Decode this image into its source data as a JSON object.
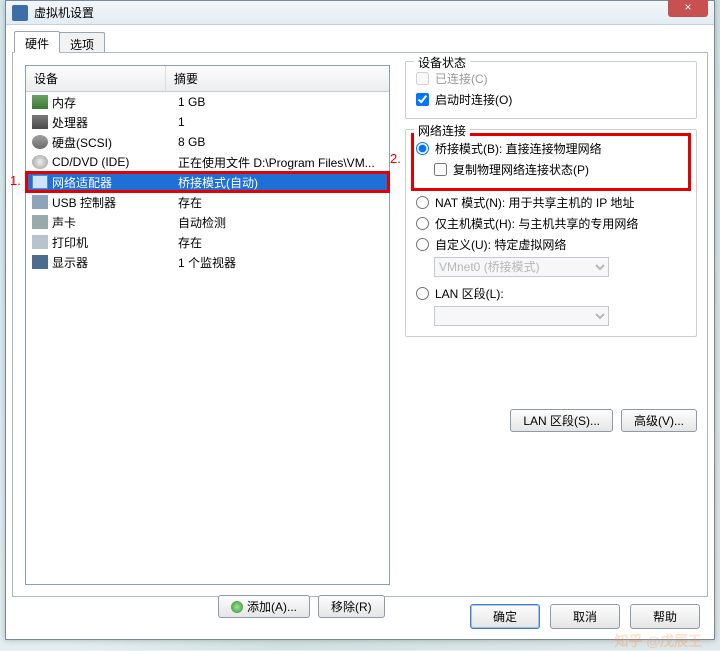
{
  "window": {
    "title": "虚拟机设置"
  },
  "tabs": {
    "hw": "硬件",
    "opt": "选项"
  },
  "columns": {
    "device": "设备",
    "summary": "摘要"
  },
  "devices": [
    {
      "icon": "mem",
      "name": "内存",
      "summary": "1 GB"
    },
    {
      "icon": "cpu",
      "name": "处理器",
      "summary": "1"
    },
    {
      "icon": "hdd",
      "name": "硬盘(SCSI)",
      "summary": "8 GB"
    },
    {
      "icon": "cd",
      "name": "CD/DVD (IDE)",
      "summary": "正在使用文件 D:\\Program Files\\VM..."
    },
    {
      "icon": "net",
      "name": "网络适配器",
      "summary": "桥接模式(自动)",
      "selected": true
    },
    {
      "icon": "usb",
      "name": "USB 控制器",
      "summary": "存在"
    },
    {
      "icon": "snd",
      "name": "声卡",
      "summary": "自动检测"
    },
    {
      "icon": "prn",
      "name": "打印机",
      "summary": "存在"
    },
    {
      "icon": "mon",
      "name": "显示器",
      "summary": "1 个监视器"
    }
  ],
  "list_buttons": {
    "add": "添加(A)...",
    "remove": "移除(R)"
  },
  "status": {
    "legend": "设备状态",
    "connected": "已连接(C)",
    "connect_on": "启动时连接(O)"
  },
  "netconn": {
    "legend": "网络连接",
    "bridged": "桥接模式(B): 直接连接物理网络",
    "replicate": "复制物理网络连接状态(P)",
    "nat": "NAT 模式(N): 用于共享主机的 IP 地址",
    "hostonly": "仅主机模式(H): 与主机共享的专用网络",
    "custom": "自定义(U): 特定虚拟网络",
    "custom_value": "VMnet0 (桥接模式)",
    "lan": "LAN 区段(L):"
  },
  "right_buttons": {
    "lan": "LAN 区段(S)...",
    "adv": "高级(V)..."
  },
  "dlg": {
    "ok": "确定",
    "cancel": "取消",
    "help": "帮助"
  },
  "annot": {
    "one": "1.",
    "two": "2."
  }
}
